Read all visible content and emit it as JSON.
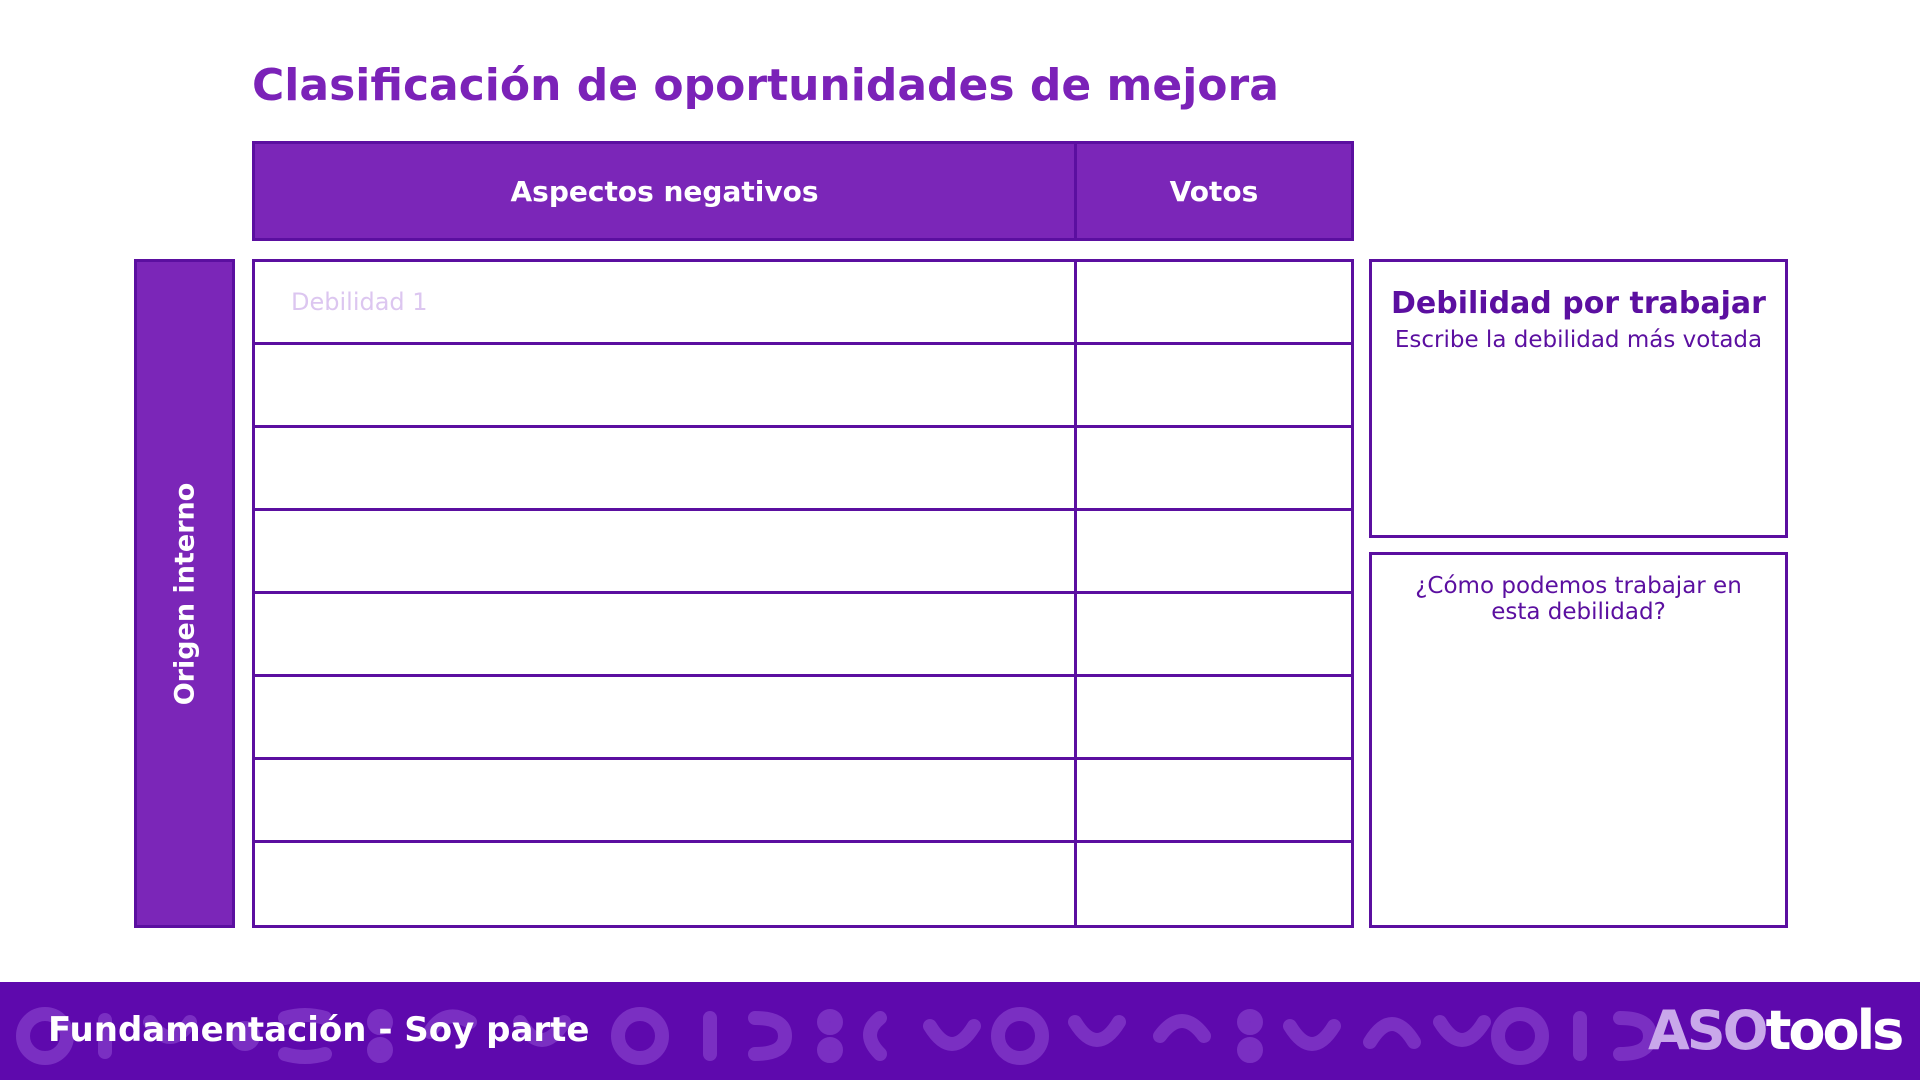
{
  "title": "Clasificación de oportunidades de mejora",
  "table": {
    "headers": {
      "aspectos": "Aspectos negativos",
      "votos": "Votos"
    },
    "side_label": "Origen interno",
    "rows": [
      {
        "aspecto": "Debilidad 1",
        "votos": ""
      },
      {
        "aspecto": "",
        "votos": ""
      },
      {
        "aspecto": "",
        "votos": ""
      },
      {
        "aspecto": "",
        "votos": ""
      },
      {
        "aspecto": "",
        "votos": ""
      },
      {
        "aspecto": "",
        "votos": ""
      },
      {
        "aspecto": "",
        "votos": ""
      },
      {
        "aspecto": "",
        "votos": ""
      }
    ]
  },
  "panels": {
    "debilidad": {
      "title": "Debilidad por trabajar",
      "subtitle": "Escribe la debilidad más votada"
    },
    "como": {
      "question": "¿Cómo podemos trabajar en esta debilidad?"
    }
  },
  "footer": {
    "text": "Fundamentación - Soy parte",
    "logo_part1": "ASO",
    "logo_part2": "tools"
  },
  "colors": {
    "primary": "#7b26b8",
    "dark": "#5b0fa0",
    "footer_bg": "#5e09ad",
    "placeholder": "#dcc6f0"
  }
}
